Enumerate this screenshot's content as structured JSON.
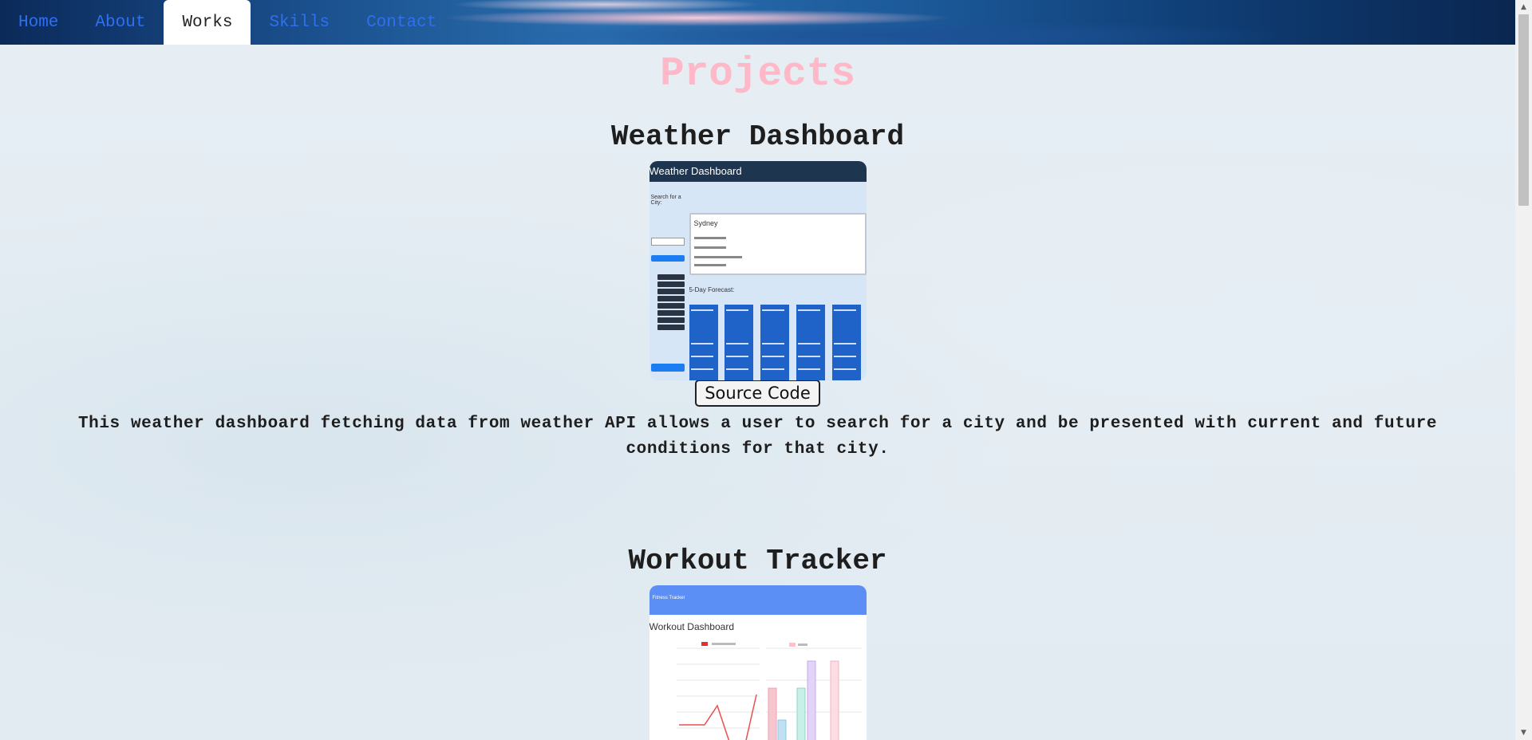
{
  "nav": {
    "items": [
      {
        "label": "Home"
      },
      {
        "label": "About"
      },
      {
        "label": "Works"
      },
      {
        "label": "Skills"
      },
      {
        "label": "Contact"
      }
    ],
    "active_index": 2
  },
  "page": {
    "section_title": "Projects"
  },
  "projects": [
    {
      "title": "Weather Dashboard",
      "button_label": "Source Code",
      "description": "This weather dashboard fetching data from weather API allows a user to search for a city and be presented with current and future conditions for that city.",
      "thumbnail": {
        "header": "Weather Dashboard",
        "search_label": "Search for a City:",
        "current_city": "Sydney",
        "forecast_label": "5-Day Forecast:"
      }
    },
    {
      "title": "Workout Tracker",
      "thumbnail": {
        "nav_label": "Fitness Tracker",
        "header": "Workout Dashboard"
      }
    }
  ],
  "colors": {
    "nav_link": "#2f6ff0",
    "section_title": "#ffb8c8",
    "heading": "#1e1e1e"
  },
  "icons": {
    "scroll_up": "triangle-up-icon",
    "scroll_down": "triangle-down-icon"
  }
}
